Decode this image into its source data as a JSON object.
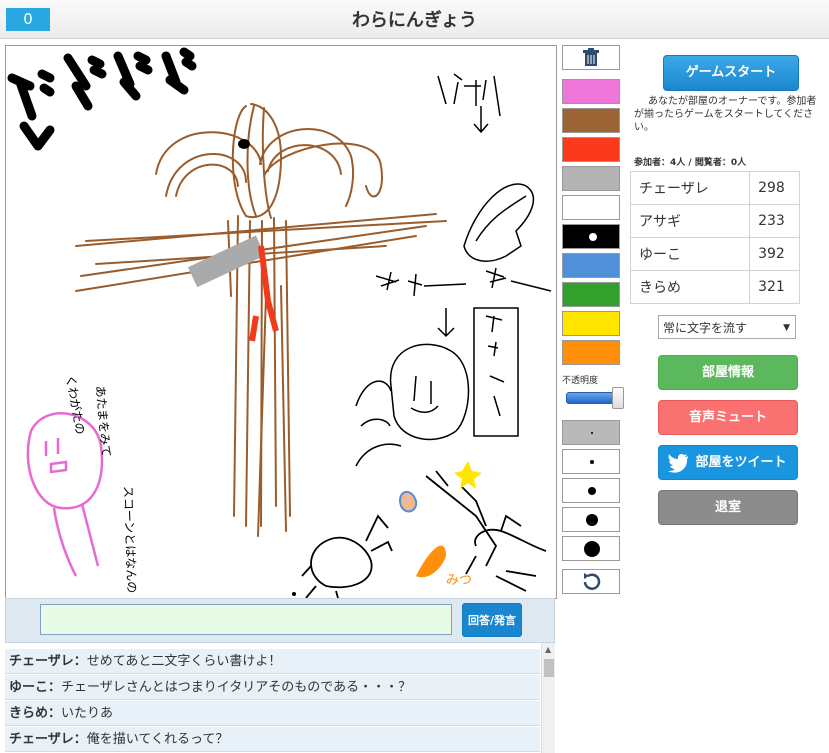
{
  "header": {
    "score": "0",
    "title": "わらにんぎょう"
  },
  "canvas": {
    "texts": [
      "イタリア",
      "↓",
      "チェーザレ",
      "チェーザレ",
      "↓",
      "チェーザレ",
      "くわがたの",
      "あたまをみて",
      "スコーンとはなんの",
      "みつ"
    ]
  },
  "palette": {
    "trash_icon": "trash-icon",
    "colors": [
      "#ef76d9",
      "#9c6535",
      "#fb3a1d",
      "#b3b3b3",
      "#ffffff",
      "#000000",
      "#4f90d9",
      "#33a02c",
      "#ffe600",
      "#ff8f0b"
    ],
    "opacity_label": "不透明度",
    "undo_icon": "undo-icon"
  },
  "sidebar": {
    "start_button": "ゲームスタート",
    "owner_note": "あなたが部屋のオーナーです。参加者が揃ったらゲームをスタートしてください。",
    "participants_label": "参加者：",
    "participants_value": "4人",
    "spectators_label": "閲覧者：",
    "spectators_value": "0人",
    "players": [
      {
        "name": "チェーザレ",
        "score": "298"
      },
      {
        "name": "アサギ",
        "score": "233"
      },
      {
        "name": "ゆーこ",
        "score": "392"
      },
      {
        "name": "きらめ",
        "score": "321"
      }
    ],
    "text_mode": "常に文字を流す",
    "room_info_button": "部屋情報",
    "mute_button": "音声ミュート",
    "tweet_button": "部屋をツイート",
    "exit_button": "退室"
  },
  "chat": {
    "input_value": "",
    "send_button": "回答/発言",
    "messages": [
      {
        "user": "チェーザレ",
        "text": "せめてあと二文字くらい書けよ！"
      },
      {
        "user": "ゆーこ",
        "text": "チェーザレさんとはつまりイタリアそのものである・・・？"
      },
      {
        "user": "きらめ",
        "text": "いたりあ"
      },
      {
        "user": "チェーザレ",
        "text": "俺を描いてくれるって？"
      }
    ]
  }
}
